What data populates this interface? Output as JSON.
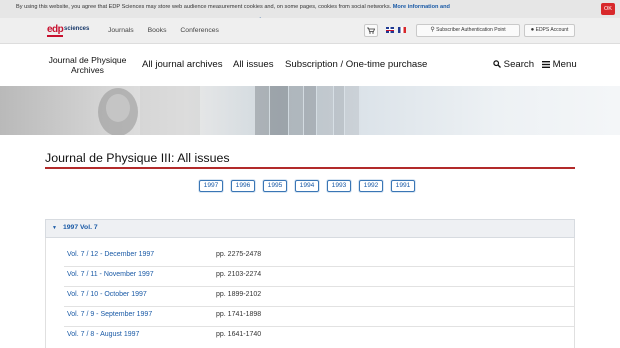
{
  "cookie": {
    "text": "By using this website, you agree that EDP Sciences may store web audience measurement cookies and, on some pages, cookies from social networks.",
    "link_part1": "More information and",
    "link_part2": "setup",
    "ok_label": "OK"
  },
  "topbar": {
    "logo_text": "edp",
    "logo_sub": "sciences",
    "nav": [
      "Journals",
      "Books",
      "Conferences"
    ],
    "subscriber_label": "Subscriber Authentication Point",
    "account_label": "EDPS Account"
  },
  "header": {
    "journal_title": "Journal de Physique Archives",
    "nav": [
      "All journal archives",
      "All issues",
      "Subscription / One-time purchase"
    ],
    "search_label": "Search",
    "menu_label": "Menu"
  },
  "page": {
    "title": "Journal de Physique III: All issues",
    "years": [
      "1997",
      "1996",
      "1995",
      "1994",
      "1993",
      "1992",
      "1991"
    ]
  },
  "accordion": {
    "label": "1997 Vol. 7",
    "issues": [
      {
        "label": "Vol. 7 / 12 - December 1997",
        "pages": "pp. 2275-2478"
      },
      {
        "label": "Vol. 7 / 11 - November 1997",
        "pages": "pp. 2103-2274"
      },
      {
        "label": "Vol. 7 / 10 - October 1997",
        "pages": "pp. 1899-2102"
      },
      {
        "label": "Vol. 7 / 9 - September 1997",
        "pages": "pp. 1741-1898"
      },
      {
        "label": "Vol. 7 / 8 - August 1997",
        "pages": "pp. 1641-1740"
      }
    ]
  }
}
